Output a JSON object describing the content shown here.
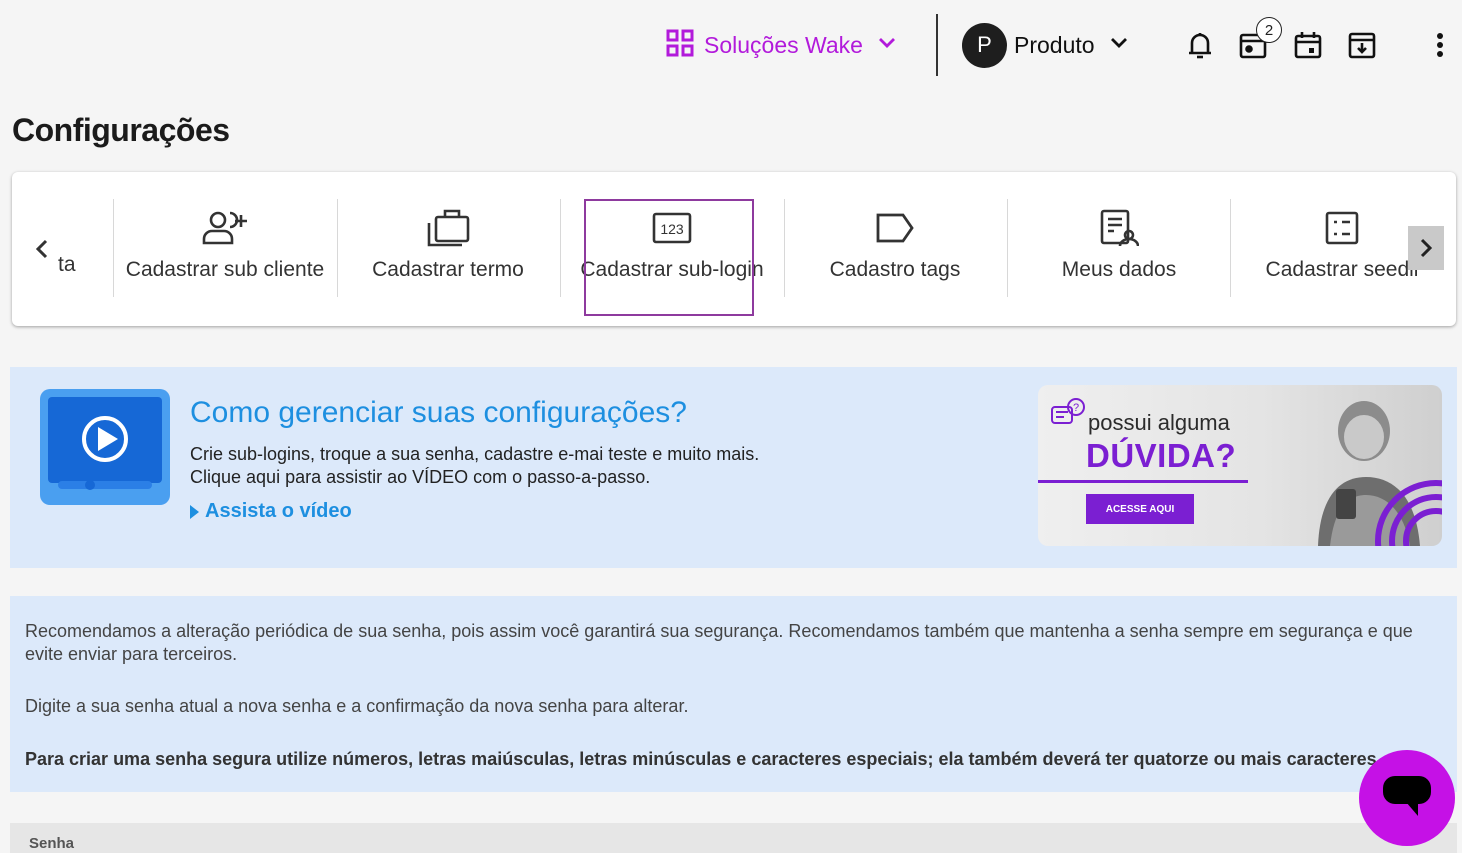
{
  "topbar": {
    "solucoes_label": "Soluções Wake",
    "produto_avatar": "P",
    "produto_label": "Produto",
    "badge_count": "2",
    "icons": [
      "grid-icon",
      "bell-icon",
      "inbox-icon",
      "calendar-icon",
      "download-icon",
      "more-vertical-icon"
    ],
    "accent_color": "#b21adb"
  },
  "page": {
    "title": "Configurações"
  },
  "carousel": {
    "partial_label": "ta",
    "items": [
      {
        "label": "Cadastrar sub cliente",
        "icon": "add-user-icon"
      },
      {
        "label": "Cadastrar termo",
        "icon": "briefcase-icon"
      },
      {
        "label": "Cadastrar sub-login",
        "icon": "numeric-123-icon",
        "selected": true
      },
      {
        "label": "Cadastro tags",
        "icon": "tag-icon"
      },
      {
        "label": "Meus dados",
        "icon": "user-document-icon"
      },
      {
        "label": "Cadastrar seedli",
        "icon": "list-icon"
      }
    ],
    "selected_color": "#8e3a9e"
  },
  "video": {
    "title": "Como gerenciar suas configurações?",
    "line1": "Crie sub-logins, troque a sua senha, cadastre e-mai teste e muito mais.",
    "line2": "Clique aqui para assistir ao VÍDEO com o passo-a-passo.",
    "link": "Assista o vídeo",
    "promo_line1": "possui alguma",
    "promo_line2": "DÚVIDA?",
    "promo_button": "ACESSE AQUI"
  },
  "info": {
    "p1": "Recomendamos a alteração periódica de sua senha, pois assim você garantirá sua segurança. Recomendamos também que mantenha a senha sempre em segurança e que evite enviar para terceiros.",
    "p2": "Digite a sua senha atual a nova senha e a confirmação da nova senha para alterar.",
    "p3": "Para criar uma senha segura utilize números, letras maiúsculas, letras minúsculas e caracteres especiais; ela também deverá ter quatorze ou mais caracteres."
  },
  "form": {
    "senha_label": "Senha"
  }
}
